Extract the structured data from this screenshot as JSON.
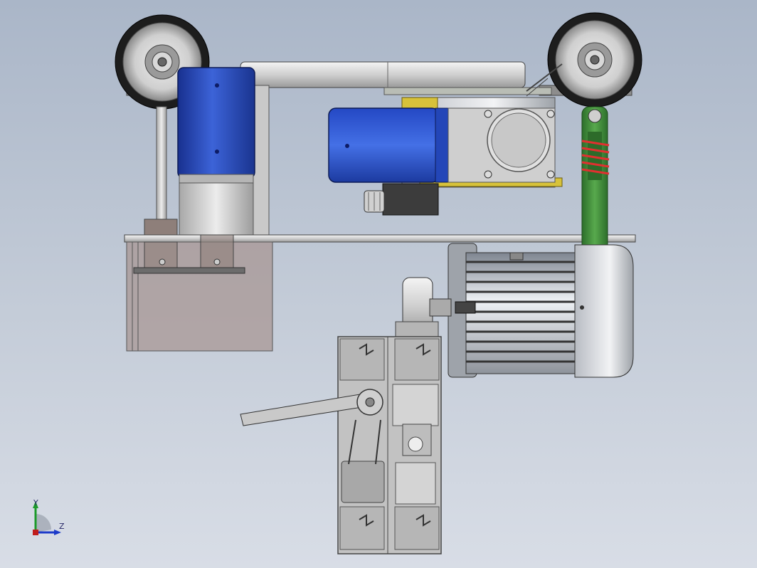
{
  "window": {
    "background_top": "#aab6c8",
    "background_bottom": "#d8dde6"
  },
  "colors": {
    "motor_blue": "#1f3fb0",
    "motor_blue_light": "#4b6fe0",
    "plate_grey": "#9c9c9c",
    "aluminum": "#d6d6d6",
    "green_arm": "#3f8f3a",
    "spring_red": "#e03030",
    "bracket_yellow": "#d7c23a",
    "tank_brown": "#a58f8a",
    "wheel_dark": "#222222",
    "fin_silver": "#e4e8ee"
  },
  "triad": {
    "y_label": "Y",
    "z_label": "Z",
    "icon": "coordinate-triad-icon"
  }
}
